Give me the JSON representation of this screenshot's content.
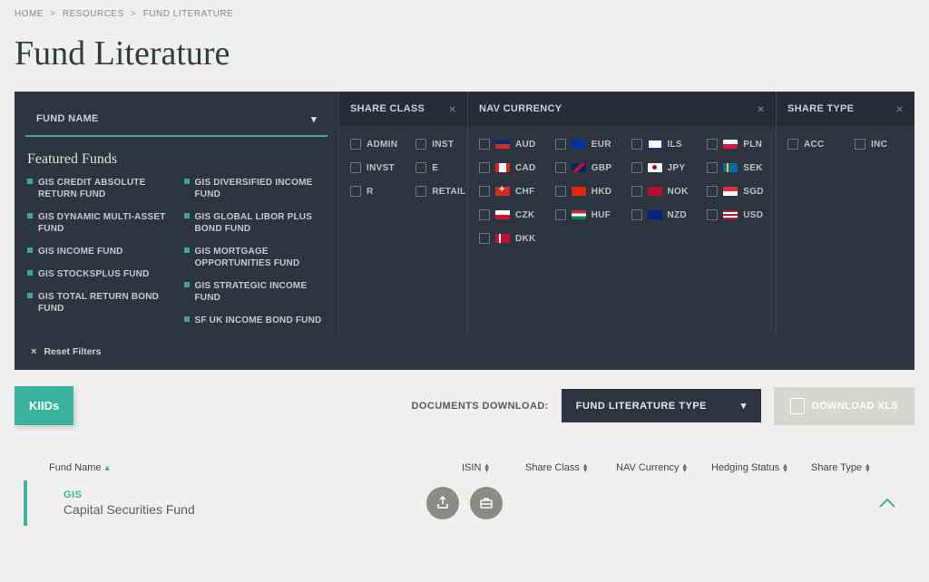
{
  "breadcrumb": [
    "HOME",
    "RESOURCES",
    "FUND LITERATURE"
  ],
  "page_title": "Fund Literature",
  "filters": {
    "fund_name": {
      "header": "FUND NAME"
    },
    "share_class": {
      "header": "SHARE CLASS",
      "options": [
        "ADMIN",
        "INVST",
        "R",
        "INST",
        "E",
        "RETAIL"
      ]
    },
    "nav_currency": {
      "header": "NAV CURRENCY",
      "options": [
        {
          "code": "AUD",
          "flag": "aud"
        },
        {
          "code": "CAD",
          "flag": "cad"
        },
        {
          "code": "CHF",
          "flag": "chf"
        },
        {
          "code": "CZK",
          "flag": "czk"
        },
        {
          "code": "DKK",
          "flag": "dkk"
        },
        {
          "code": "EUR",
          "flag": "eur"
        },
        {
          "code": "GBP",
          "flag": "gbp"
        },
        {
          "code": "HKD",
          "flag": "hkd"
        },
        {
          "code": "HUF",
          "flag": "huf"
        },
        {
          "code": "ILS",
          "flag": "ils"
        },
        {
          "code": "JPY",
          "flag": "jpy"
        },
        {
          "code": "NOK",
          "flag": "nok"
        },
        {
          "code": "NZD",
          "flag": "nzd"
        },
        {
          "code": "PLN",
          "flag": "pln"
        },
        {
          "code": "SEK",
          "flag": "sek"
        },
        {
          "code": "SGD",
          "flag": "sgd"
        },
        {
          "code": "USD",
          "flag": "usd"
        }
      ]
    },
    "share_type": {
      "header": "SHARE TYPE",
      "options": [
        "ACC",
        "INC"
      ]
    }
  },
  "featured": {
    "title": "Featured Funds",
    "col1": [
      "GIS CREDIT ABSOLUTE RETURN FUND",
      "GIS DYNAMIC MULTI-ASSET FUND",
      "GIS INCOME FUND",
      "GIS STOCKSPLUS FUND",
      "GIS TOTAL RETURN BOND FUND"
    ],
    "col2": [
      "GIS DIVERSIFIED INCOME FUND",
      "GIS GLOBAL LIBOR PLUS BOND FUND",
      "GIS MORTGAGE OPPORTUNITIES FUND",
      "GIS STRATEGIC INCOME FUND",
      "SF UK INCOME BOND FUND"
    ]
  },
  "reset_label": "Reset Filters",
  "kiids_label": "KIIDs",
  "docs_download_label": "DOCUMENTS DOWNLOAD:",
  "fund_lit_select": "FUND LITERATURE TYPE",
  "download_xls_label": "DOWNLOAD XLS",
  "table": {
    "headers": {
      "fund_name": "Fund Name",
      "isin": "ISIN",
      "share_class": "Share Class",
      "nav_currency": "NAV Currency",
      "hedging": "Hedging Status",
      "share_type": "Share Type"
    },
    "rows": [
      {
        "tag": "GIS",
        "name": "Capital Securities Fund"
      }
    ]
  }
}
